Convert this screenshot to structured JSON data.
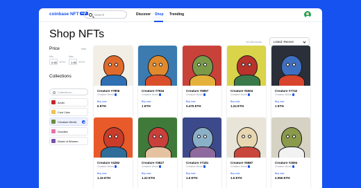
{
  "app": {
    "logo": "coinbase NFT",
    "beta_badge": "BETA"
  },
  "header": {
    "search_placeholder": "Search",
    "nav": [
      {
        "label": "Discover"
      },
      {
        "label": "Shop",
        "active": true
      },
      {
        "label": "Trending"
      }
    ]
  },
  "page": {
    "title": "Shop NFTs",
    "items_count": "10,000 items",
    "sort_label": "Listed: Recent"
  },
  "sidebar": {
    "price": {
      "title": "Price",
      "hide_label": "Hide",
      "min_label": "Min",
      "max_label": "Max",
      "min_value": "0.55",
      "min_unit": "ETH",
      "max_value": "1.95",
      "max_unit": "ETH"
    },
    "collections": {
      "title": "Collections",
      "filter_placeholder": "Collections...",
      "items": [
        {
          "label": "Azuki",
          "color": "#c0262d",
          "selected": false
        },
        {
          "label": "Cool Cats",
          "color": "#f2c14e",
          "selected": false
        },
        {
          "label": "Creature World",
          "color": "#6a8f3a",
          "selected": true
        },
        {
          "label": "Doodles",
          "color": "#e86fa8",
          "selected": false
        },
        {
          "label": "World of Women",
          "color": "#7b4fb0",
          "selected": false
        }
      ]
    }
  },
  "cards": [
    {
      "name": "Creature #7806",
      "collection": "Creature World",
      "action": "Buy now",
      "price": "6 ETH",
      "bg": "#f2eee6",
      "fg": "#e06a2c",
      "body": "#2f6fb3"
    },
    {
      "name": "Creature #7934",
      "collection": "Creature World",
      "action": "Buy now",
      "price": "1 ETH",
      "bg": "#3b7bb0",
      "fg": "#e08a2e",
      "body": "#d94f2a"
    },
    {
      "name": "Creature #5997",
      "collection": "Creature World",
      "action": "Buy now",
      "price": "0.475 ETH",
      "bg": "#c9423a",
      "fg": "#7a9a4a",
      "body": "#e4b23a"
    },
    {
      "name": "Creature #6304",
      "collection": "Creature World",
      "action": "Buy now",
      "price": "1.24 ETH",
      "bg": "#d9d44a",
      "fg": "#b8332c",
      "body": "#3a7a4a"
    },
    {
      "name": "Creature #7742",
      "collection": "Creature World",
      "action": "Buy now",
      "price": "1 ETH",
      "bg": "#2a2f3a",
      "fg": "#3f6fc0",
      "body": "#d8442c"
    },
    {
      "name": "Creature #4282",
      "collection": "Creature World",
      "action": "Buy now",
      "price": "1.15 ETH",
      "bg": "#e85a2a",
      "fg": "#c93c2a",
      "body": "#2f6e9a"
    },
    {
      "name": "Creature #3627",
      "collection": "Creature World",
      "action": "Buy now",
      "price": "1.22 ETH",
      "bg": "#3f7a3a",
      "fg": "#c9403a",
      "body": "#e6c2a0"
    },
    {
      "name": "Creature #7181",
      "collection": "Creature World",
      "action": "Buy now",
      "price": "1.5 ETH",
      "bg": "#3c4a8c",
      "fg": "#8ab0c8",
      "body": "#8e6a9e"
    },
    {
      "name": "Creature #6687",
      "collection": "Creature World",
      "action": "Buy now",
      "price": "1.5 ETH",
      "bg": "#e9e4d8",
      "fg": "#e8d6b0",
      "body": "#c9463a"
    },
    {
      "name": "Creature #2694",
      "collection": "Creature World",
      "action": "Buy now",
      "price": "2.056 ETH",
      "bg": "#d6d2c4",
      "fg": "#8a9a4a",
      "body": "#f2f2f2"
    }
  ]
}
